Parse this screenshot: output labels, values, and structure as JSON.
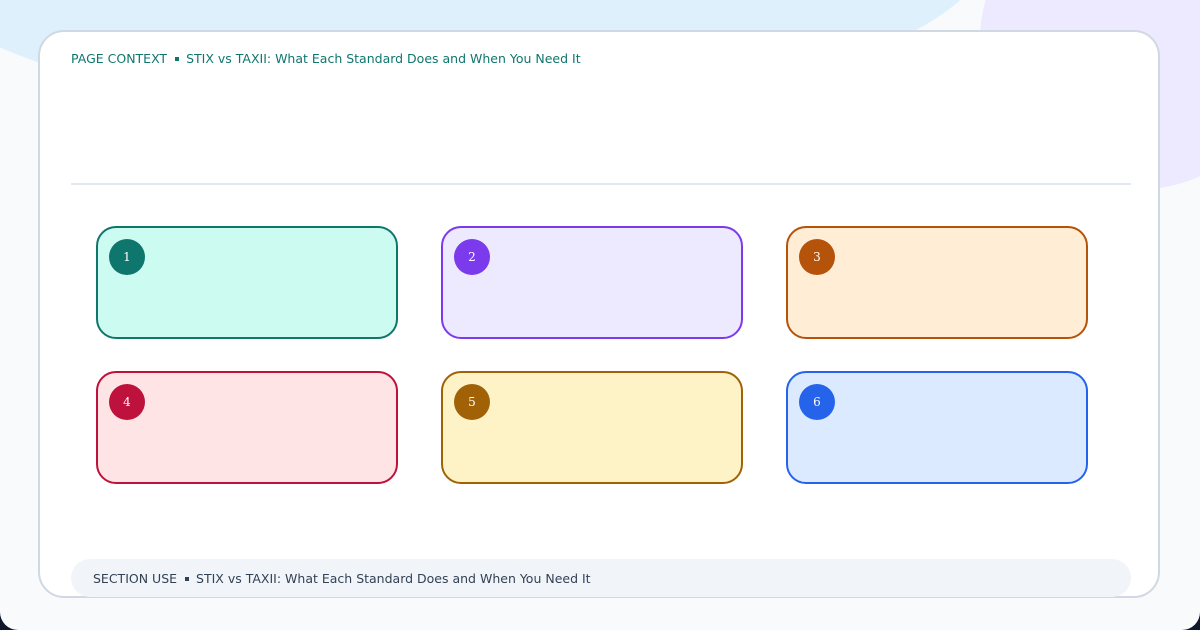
{
  "header": {
    "label": "PAGE CONTEXT",
    "title": "STIX vs TAXII: What Each Standard Does and When You Need It"
  },
  "cards": [
    {
      "number": "1",
      "color": "#0f766e"
    },
    {
      "number": "2",
      "color": "#7c3aed"
    },
    {
      "number": "3",
      "color": "#b45309"
    },
    {
      "number": "4",
      "color": "#be123c"
    },
    {
      "number": "5",
      "color": "#a16207"
    },
    {
      "number": "6",
      "color": "#2563eb"
    }
  ],
  "footer": {
    "label": "SECTION USE",
    "title": "STIX vs TAXII: What Each Standard Does and When You Need It"
  }
}
